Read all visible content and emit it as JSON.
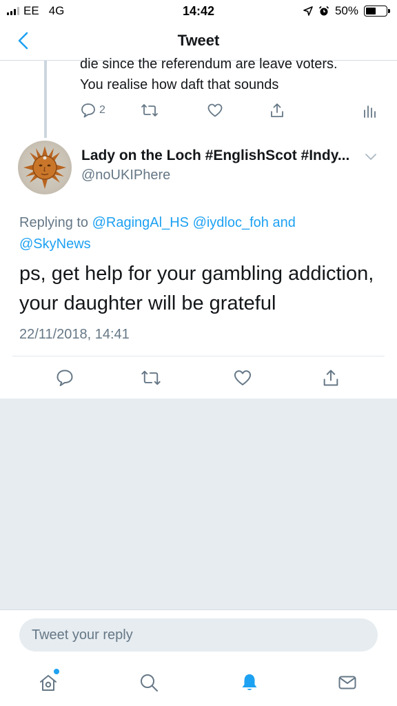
{
  "status_bar": {
    "carrier": "EE",
    "network": "4G",
    "time": "14:42",
    "battery_text": "50%",
    "battery_level": 0.5
  },
  "nav": {
    "title": "Tweet",
    "back_icon": "chevron-left-icon"
  },
  "previous_tweet": {
    "text_line1": "die since the referendum are leave voters.",
    "text_line2": "You realise how daft that sounds",
    "reply_count": "2"
  },
  "tweet": {
    "author_name": "Lady on the Loch #EnglishScot #Indy...",
    "author_handle": "@noUKIPhere",
    "replying_prefix": "Replying to ",
    "mention_1": "@RagingAl_HS",
    "mention_2": "@iydloc_foh",
    "and_word": " and",
    "mention_3": "@SkyNews",
    "body": "ps, get help for your gambling addiction, your daughter will be grateful",
    "timestamp": "22/11/2018, 14:41"
  },
  "reply_bar": {
    "placeholder": "Tweet your reply"
  },
  "colors": {
    "accent": "#1da1f2",
    "secondary_text": "#657786",
    "background_gray": "#e6ecf0"
  }
}
